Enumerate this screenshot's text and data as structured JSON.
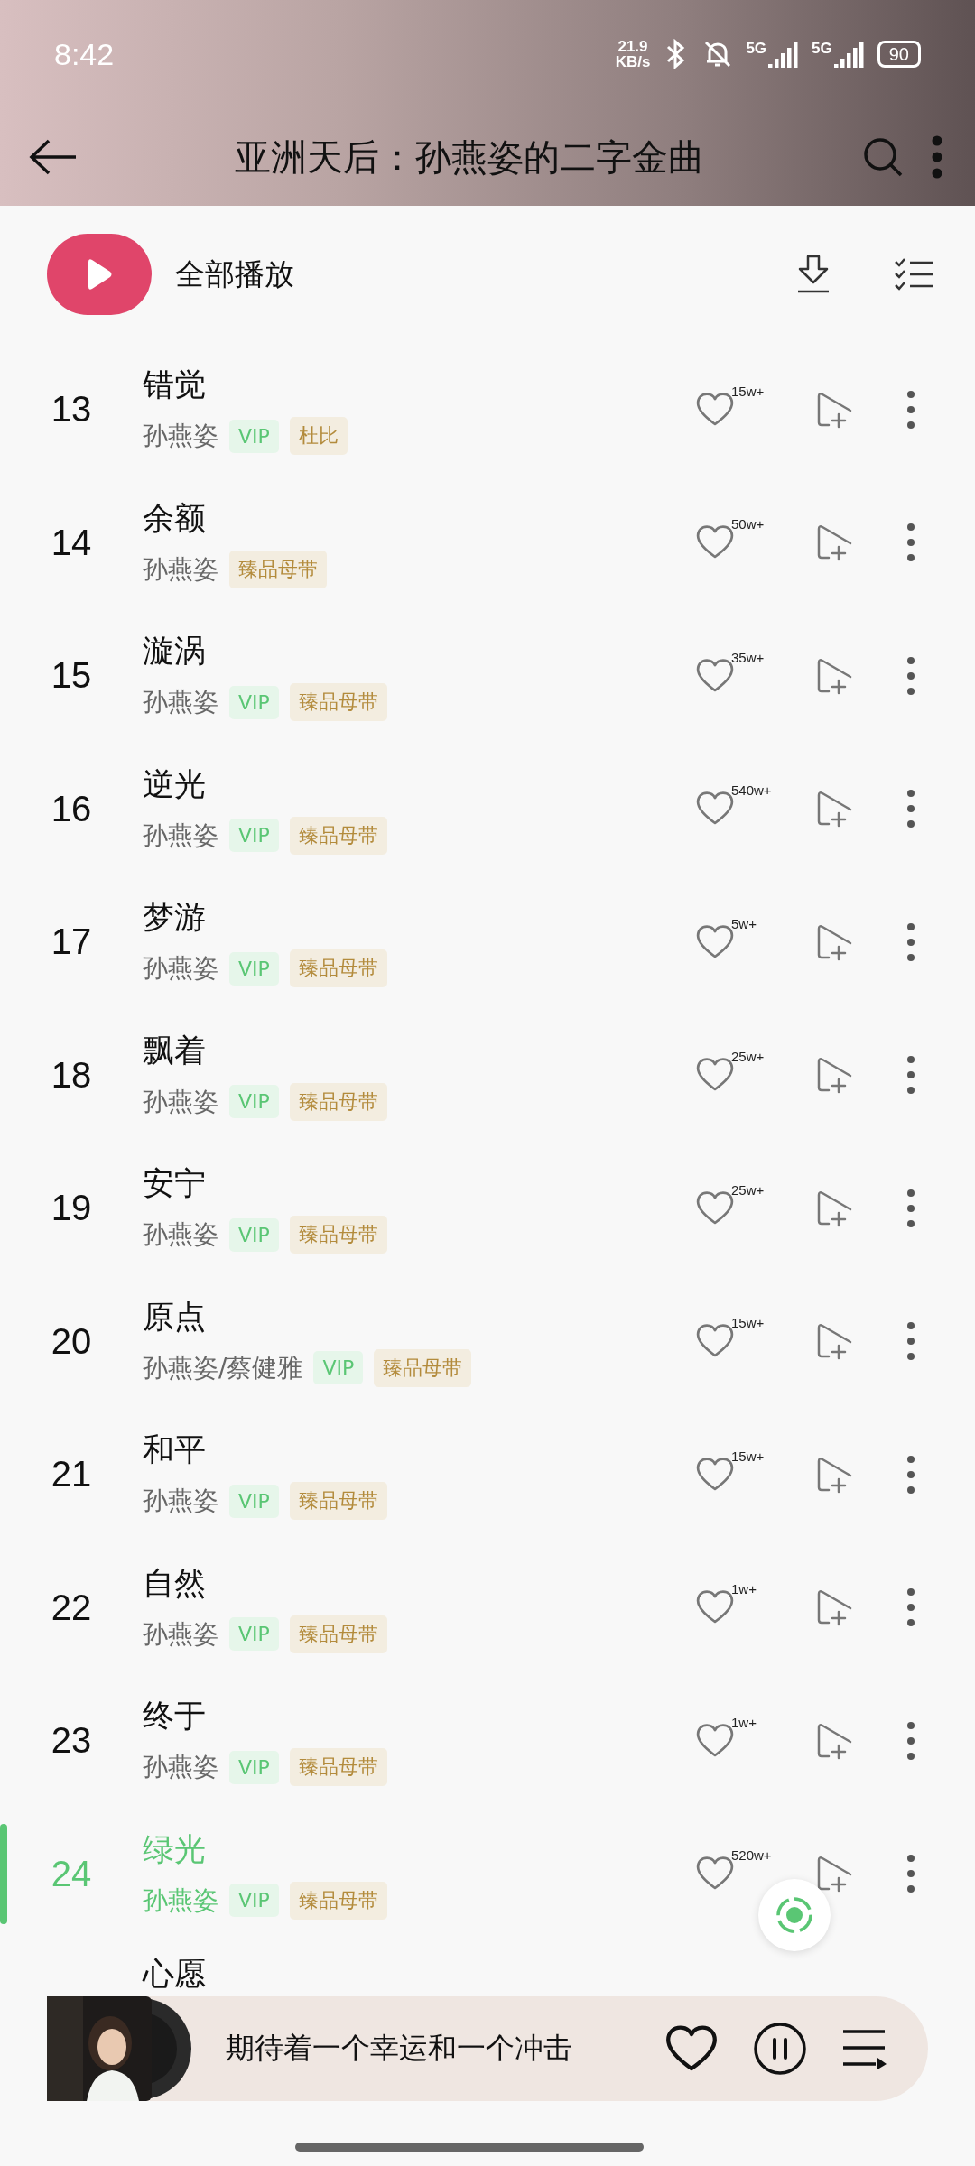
{
  "status_bar": {
    "time": "8:42",
    "net_speed_value": "21.9",
    "net_speed_unit": "KB/s",
    "network_1": "5G",
    "network_2": "5G",
    "battery": "90"
  },
  "toolbar": {
    "title": "亚洲天后：孙燕姿的二字金曲"
  },
  "play_all": {
    "label": "全部播放"
  },
  "songs": [
    {
      "number": "13",
      "title": "错觉",
      "artist": "孙燕姿",
      "tags": [
        {
          "kind": "vip",
          "text": "VIP"
        },
        {
          "kind": "quality",
          "text": "杜比"
        }
      ],
      "likes": "15w+",
      "selected": false
    },
    {
      "number": "14",
      "title": "余额",
      "artist": "孙燕姿",
      "tags": [
        {
          "kind": "quality",
          "text": "臻品母带"
        }
      ],
      "likes": "50w+",
      "selected": false
    },
    {
      "number": "15",
      "title": "漩涡",
      "artist": "孙燕姿",
      "tags": [
        {
          "kind": "vip",
          "text": "VIP"
        },
        {
          "kind": "quality",
          "text": "臻品母带"
        }
      ],
      "likes": "35w+",
      "selected": false
    },
    {
      "number": "16",
      "title": "逆光",
      "artist": "孙燕姿",
      "tags": [
        {
          "kind": "vip",
          "text": "VIP"
        },
        {
          "kind": "quality",
          "text": "臻品母带"
        }
      ],
      "likes": "540w+",
      "selected": false
    },
    {
      "number": "17",
      "title": "梦游",
      "artist": "孙燕姿",
      "tags": [
        {
          "kind": "vip",
          "text": "VIP"
        },
        {
          "kind": "quality",
          "text": "臻品母带"
        }
      ],
      "likes": "5w+",
      "selected": false
    },
    {
      "number": "18",
      "title": "飘着",
      "artist": "孙燕姿",
      "tags": [
        {
          "kind": "vip",
          "text": "VIP"
        },
        {
          "kind": "quality",
          "text": "臻品母带"
        }
      ],
      "likes": "25w+",
      "selected": false
    },
    {
      "number": "19",
      "title": "安宁",
      "artist": "孙燕姿",
      "tags": [
        {
          "kind": "vip",
          "text": "VIP"
        },
        {
          "kind": "quality",
          "text": "臻品母带"
        }
      ],
      "likes": "25w+",
      "selected": false
    },
    {
      "number": "20",
      "title": "原点",
      "artist": "孙燕姿/蔡健雅",
      "tags": [
        {
          "kind": "vip",
          "text": "VIP"
        },
        {
          "kind": "quality",
          "text": "臻品母带"
        }
      ],
      "likes": "15w+",
      "selected": false
    },
    {
      "number": "21",
      "title": "和平",
      "artist": "孙燕姿",
      "tags": [
        {
          "kind": "vip",
          "text": "VIP"
        },
        {
          "kind": "quality",
          "text": "臻品母带"
        }
      ],
      "likes": "15w+",
      "selected": false
    },
    {
      "number": "22",
      "title": "自然",
      "artist": "孙燕姿",
      "tags": [
        {
          "kind": "vip",
          "text": "VIP"
        },
        {
          "kind": "quality",
          "text": "臻品母带"
        }
      ],
      "likes": "1w+",
      "selected": false
    },
    {
      "number": "23",
      "title": "终于",
      "artist": "孙燕姿",
      "tags": [
        {
          "kind": "vip",
          "text": "VIP"
        },
        {
          "kind": "quality",
          "text": "臻品母带"
        }
      ],
      "likes": "1w+",
      "selected": false
    },
    {
      "number": "24",
      "title": "绿光",
      "artist": "孙燕姿",
      "tags": [
        {
          "kind": "vip",
          "text": "VIP"
        },
        {
          "kind": "quality",
          "text": "臻品母带"
        }
      ],
      "likes": "520w+",
      "selected": true
    }
  ],
  "partial_song": {
    "title": "心愿"
  },
  "player": {
    "lyric": "期待着一个幸运和一个冲击",
    "playing": true
  }
}
